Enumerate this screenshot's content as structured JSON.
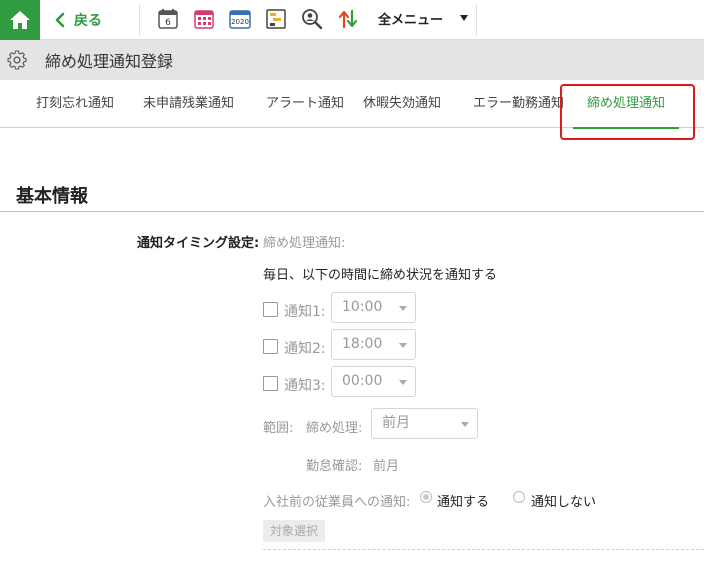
{
  "toolbar": {
    "back_label": "戻る",
    "all_menu_label": "全メニュー",
    "icons": [
      "calendar-6-icon",
      "calendar-grid-icon",
      "calendar-2020-icon",
      "gantt-list-icon",
      "user-search-icon",
      "sort-updown-icon"
    ],
    "calendar_day": "6",
    "calendar_year": "2020"
  },
  "title_bar": {
    "title": "締め処理通知登録"
  },
  "tabs": [
    {
      "label": "打刻忘れ通知"
    },
    {
      "label": "未申請残業通知"
    },
    {
      "label": "アラート通知"
    },
    {
      "label": "休暇失効通知"
    },
    {
      "label": "エラー勤務通知"
    },
    {
      "label": "締め処理通知",
      "active": true
    }
  ],
  "section": {
    "title": "基本情報"
  },
  "form": {
    "timing_label": "通知タイミング設定:",
    "timing_sub": "締め処理通知:",
    "description": "毎日、以下の時間に締め状況を通知する",
    "notifications": [
      {
        "label": "通知1:",
        "value": "10:00"
      },
      {
        "label": "通知2:",
        "value": "18:00"
      },
      {
        "label": "通知3:",
        "value": "00:00"
      }
    ],
    "range_label": "範囲:",
    "closing_label": "締め処理:",
    "closing_value": "前月",
    "attendance_label": "勤怠確認:",
    "attendance_value": "前月",
    "pre_hire_label": "入社前の従業員への通知:",
    "notify_yes": "通知する",
    "notify_no": "通知しない",
    "target_button": "対象選択"
  },
  "colors": {
    "accent": "#2e9c3f",
    "highlight": "#e0191b",
    "titlebar_bg": "#e4e4e4"
  }
}
